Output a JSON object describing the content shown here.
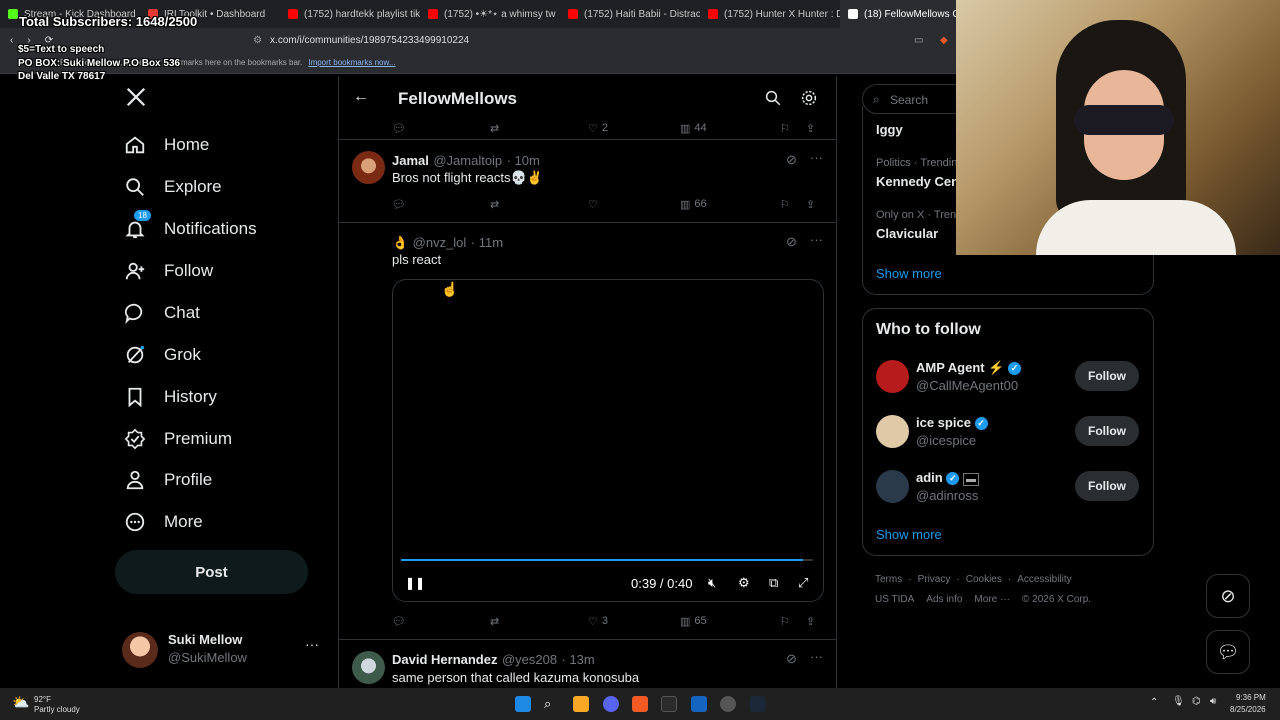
{
  "browser": {
    "tabs": [
      {
        "label": "Stream - Kick Dashboard",
        "color": "#53fc18"
      },
      {
        "label": "IRLToolkit • Dashboard",
        "color": "#e53935"
      },
      {
        "label": "(1752) hardtekk playlist tiktok",
        "color": "#ff0000"
      },
      {
        "label": "(1752) •☀︎*⋆ a whimsy tw",
        "color": "#ff0000"
      },
      {
        "label": "(1752) Haiti Babii - Distraction",
        "color": "#ff0000"
      },
      {
        "label": "(1752) Hunter X Hunter : Depa",
        "color": "#ff0000"
      },
      {
        "label": "(18) FellowMellows Comm",
        "color": "#ffffff"
      }
    ],
    "url": "x.com/i/communities/1989754233499910224",
    "bookmarks_text": "For quick access, place your bookmarks here on the bookmarks bar.",
    "bookmarks_link": "Import bookmarks now..."
  },
  "overlay": {
    "subs": "Total Subscribers: 1648/2500",
    "tts": "$5=Text to speech",
    "po_line1": "PO BOX: Suki Mellow P.O Box 536",
    "po_line2": "Del Valle TX 78617"
  },
  "nav": {
    "items": [
      {
        "label": "Home",
        "icon": "home-icon"
      },
      {
        "label": "Explore",
        "icon": "search-icon"
      },
      {
        "label": "Notifications",
        "icon": "bell-icon",
        "badge": "18"
      },
      {
        "label": "Follow",
        "icon": "add-person-icon"
      },
      {
        "label": "Chat",
        "icon": "chat-icon"
      },
      {
        "label": "Grok",
        "icon": "grok-icon"
      },
      {
        "label": "History",
        "icon": "bookmark-icon"
      },
      {
        "label": "Premium",
        "icon": "verified-icon"
      },
      {
        "label": "Profile",
        "icon": "person-icon"
      },
      {
        "label": "More",
        "icon": "more-circle-icon"
      }
    ],
    "post_label": "Post",
    "account_name": "Suki Mellow",
    "account_handle": "@SukiMellow"
  },
  "header": {
    "title": "FellowMellows"
  },
  "posts": {
    "top_stats": {
      "likes": "2",
      "views": "44"
    },
    "p1": {
      "name": "Jamal",
      "handle": "@Jamaltoip",
      "time": "· 10m",
      "text": "Bros not flight reacts💀✌️",
      "views": "66"
    },
    "p2": {
      "emoji": "👌",
      "handle": "@nvz_lol",
      "time": "· 11m",
      "text": "pls react",
      "video_time": "0:39 / 0:40",
      "video_progress": 0.975,
      "likes": "3",
      "views": "65"
    },
    "p3": {
      "name": "David Hernandez",
      "handle": "@yes208",
      "time": "· 13m",
      "text": "same person that called kazuma konosuba"
    }
  },
  "right": {
    "search_placeholder": "Search",
    "trends": [
      {
        "meta": "",
        "title": "Iggy"
      },
      {
        "meta": "Politics · Trending",
        "title": "Kennedy Center"
      },
      {
        "meta": "Only on X · Trending",
        "title": "Clavicular"
      }
    ],
    "show_more": "Show more",
    "wtf_title": "Who to follow",
    "follow_label": "Follow",
    "suggestions": [
      {
        "name": "AMP Agent ⚡",
        "handle": "@CallMeAgent00",
        "avatar_color": "#b71c1c"
      },
      {
        "name": "ice spice",
        "handle": "@icespice",
        "avatar_color": "#e0c9a6"
      },
      {
        "name": "adin",
        "handle": "@adinross",
        "avatar_color": "#2a3a4a"
      }
    ],
    "footer_row1": [
      "Terms",
      "Privacy",
      "Cookies",
      "Accessibility"
    ],
    "footer_row2": [
      "US TIDA",
      "Ads info",
      "More ···",
      "© 2026 X Corp."
    ]
  },
  "taskbar": {
    "temp": "92°F",
    "weather": "Partly cloudy",
    "time": "9:36 PM",
    "date": "8/25/2026"
  }
}
